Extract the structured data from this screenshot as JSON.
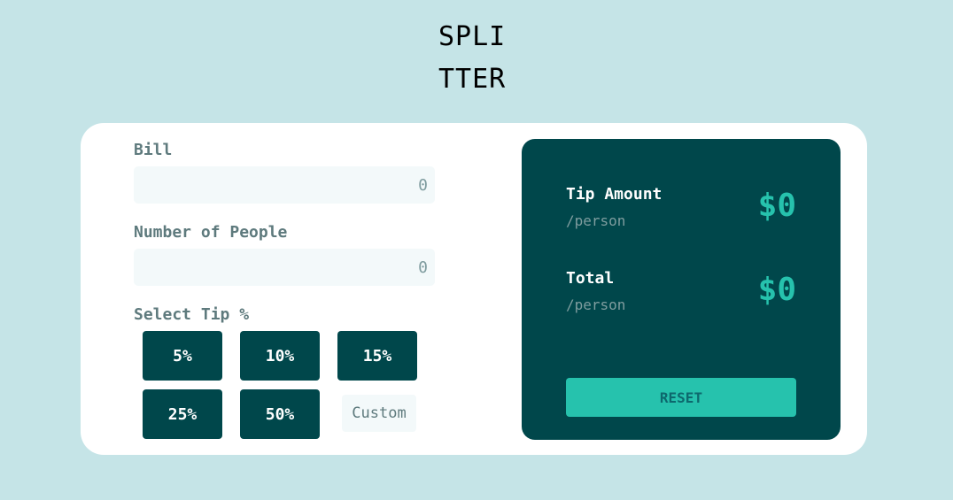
{
  "logo": {
    "line1": "SPLI",
    "line2": "TTER"
  },
  "bill": {
    "label": "Bill",
    "placeholder": "0"
  },
  "people": {
    "label": "Number of People",
    "placeholder": "0"
  },
  "tip": {
    "label": "Select Tip %",
    "options": [
      "5%",
      "10%",
      "15%",
      "25%",
      "50%"
    ],
    "custom_placeholder": "Custom"
  },
  "results": {
    "tip_amount": {
      "label": "Tip Amount",
      "sub": "/person",
      "value": "$0"
    },
    "total": {
      "label": "Total",
      "sub": "/person",
      "value": "$0"
    },
    "reset_label": "RESET"
  },
  "colors": {
    "background": "#c5e4e7",
    "dark_cyan": "#00474b",
    "strong_cyan": "#26c2ad",
    "input_bg": "#f3f9fa",
    "label_grey": "#5e7a7d"
  }
}
